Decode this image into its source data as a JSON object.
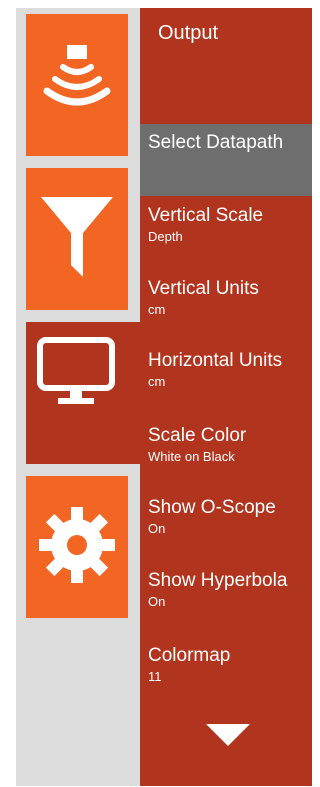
{
  "colors": {
    "accent_orange": "#f26522",
    "panel_red": "#b0341e",
    "selected_gray": "#6e6e6e",
    "sidebar_gray": "#dcdcdc",
    "text_white": "#ffffff"
  },
  "sidebar": {
    "tiles": [
      {
        "icon": "sonar-signal-icon",
        "state": "inactive"
      },
      {
        "icon": "filter-icon",
        "state": "inactive"
      },
      {
        "icon": "monitor-icon",
        "state": "active"
      },
      {
        "icon": "gear-icon",
        "state": "inactive"
      }
    ]
  },
  "menu": {
    "header": "Output",
    "selected_item": "Select Datapath",
    "items": [
      {
        "title": "Vertical Scale",
        "value": "Depth"
      },
      {
        "title": "Vertical Units",
        "value": "cm"
      },
      {
        "title": "Horizontal Units",
        "value": "cm"
      },
      {
        "title": "Scale Color",
        "value": "White on Black"
      },
      {
        "title": "Show O-Scope",
        "value": "On"
      },
      {
        "title": "Show Hyperbola",
        "value": "On"
      },
      {
        "title": "Colormap",
        "value": "11"
      }
    ],
    "scroll_icon": "chevron-down-icon"
  }
}
